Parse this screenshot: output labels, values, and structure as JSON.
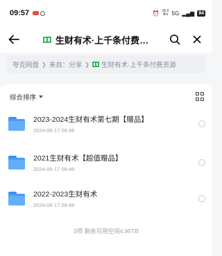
{
  "status_bar": {
    "time": "09:57",
    "net_speed_value": "35.6",
    "net_speed_unit": "B/s",
    "network": "5G",
    "battery": "94"
  },
  "header": {
    "title": "生财有术·上千条付费…",
    "back_icon": "back-arrow-icon",
    "search_icon": "search-icon",
    "close_icon": "close-icon"
  },
  "breadcrumb": {
    "items": [
      "夸克网盘",
      "来自：分享",
      "生财有术·上千条付费资源"
    ]
  },
  "toolbar": {
    "sort_label": "综合排序"
  },
  "files": [
    {
      "name": "2023-2024生财有术第七期【赠品】",
      "date": "2024-06-17 09:48"
    },
    {
      "name": "2021生财有术【超值赠品】",
      "date": "2024-06-17 09:48"
    },
    {
      "name": "2022-2023生财有术",
      "date": "2024-06-17 09:48"
    }
  ],
  "footer": {
    "summary": "3项 剩余可用空间4.95TB"
  },
  "colors": {
    "folder_blue": "#4c9cf6",
    "flag_green": "#2db55d"
  }
}
